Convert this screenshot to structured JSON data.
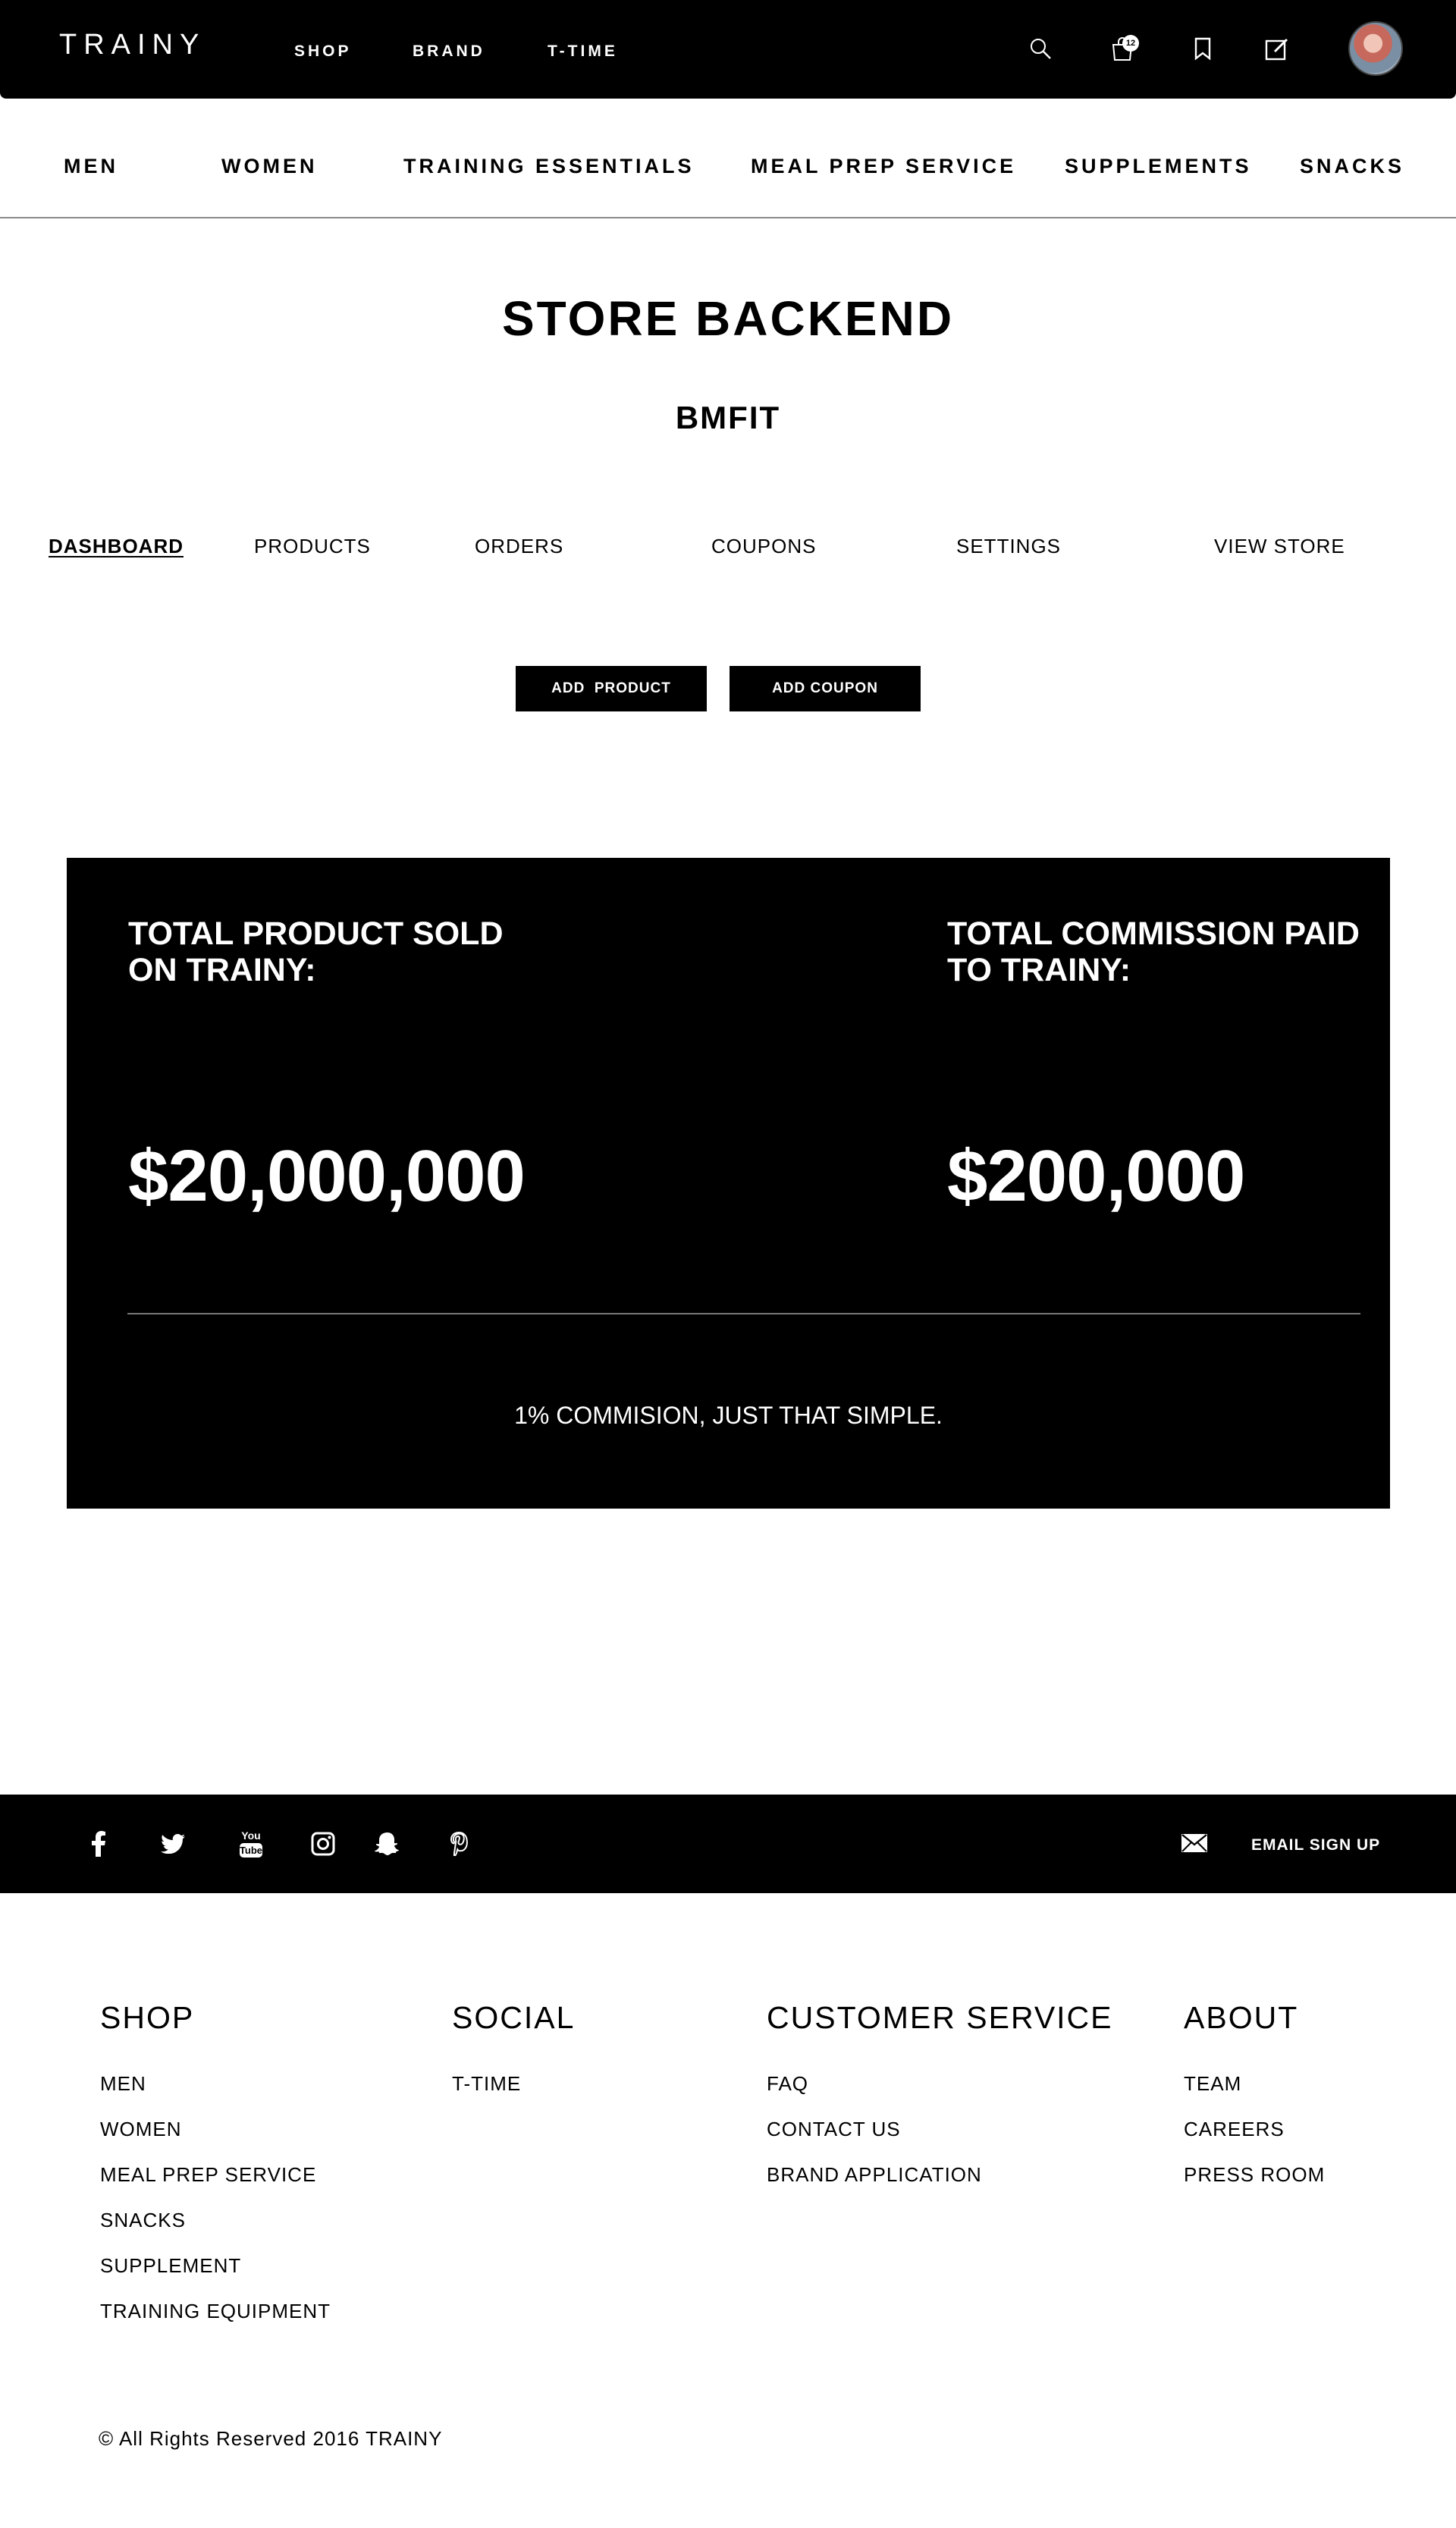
{
  "brand": {
    "logo": "TRAINY"
  },
  "top_nav": {
    "items": [
      "SHOP",
      "BRAND",
      "T-TIME"
    ]
  },
  "header_icons": {
    "search": "search-icon",
    "cart": "shopping-bag-icon",
    "cart_count": "12",
    "bookmark": "bookmark-icon",
    "edit": "edit-icon",
    "avatar": "user-avatar"
  },
  "category_nav": {
    "items": [
      "MEN",
      "WOMEN",
      "TRAINING ESSENTIALS",
      "MEAL PREP SERVICE",
      "SUPPLEMENTS",
      "SNACKS"
    ]
  },
  "page": {
    "title": "STORE BACKEND",
    "store_name": "BMFIT"
  },
  "tabs": {
    "items": [
      "DASHBOARD",
      "PRODUCTS",
      "ORDERS",
      "COUPONS",
      "SETTINGS",
      "VIEW STORE"
    ],
    "active": "DASHBOARD"
  },
  "actions": {
    "add_product": "ADD  PRODUCT",
    "add_coupon": "ADD COUPON"
  },
  "stats": {
    "sold_label": "TOTAL PRODUCT SOLD\nON TRAINY:",
    "sold_value": "$20,000,000",
    "commission_label": "TOTAL COMMISSION PAID\nTO TRAINY:",
    "commission_value": "$200,000",
    "note": "1% COMMISION, JUST THAT SIMPLE."
  },
  "social": {
    "icons": [
      "facebook-icon",
      "twitter-icon",
      "youtube-icon",
      "instagram-icon",
      "snapchat-icon",
      "pinterest-icon"
    ],
    "youtube_text": [
      "You",
      "Tube"
    ],
    "email_signup": "EMAIL SIGN UP"
  },
  "footer": {
    "shop": {
      "title": "SHOP",
      "links": [
        "MEN",
        "WOMEN",
        "MEAL PREP SERVICE",
        "SNACKS",
        "SUPPLEMENT",
        "TRAINING EQUIPMENT"
      ]
    },
    "social": {
      "title": "SOCIAL",
      "links": [
        "T-TIME"
      ]
    },
    "customer_service": {
      "title": "CUSTOMER SERVICE",
      "links": [
        "FAQ",
        "CONTACT US",
        "BRAND APPLICATION"
      ]
    },
    "about": {
      "title": "ABOUT",
      "links": [
        "TEAM",
        "CAREERS",
        "PRESS ROOM"
      ]
    },
    "copyright": "© All Rights Reserved 2016 TRAINY"
  },
  "colors": {
    "primary": "#000000",
    "background": "#ffffff",
    "divider": "#8a8a8a"
  }
}
